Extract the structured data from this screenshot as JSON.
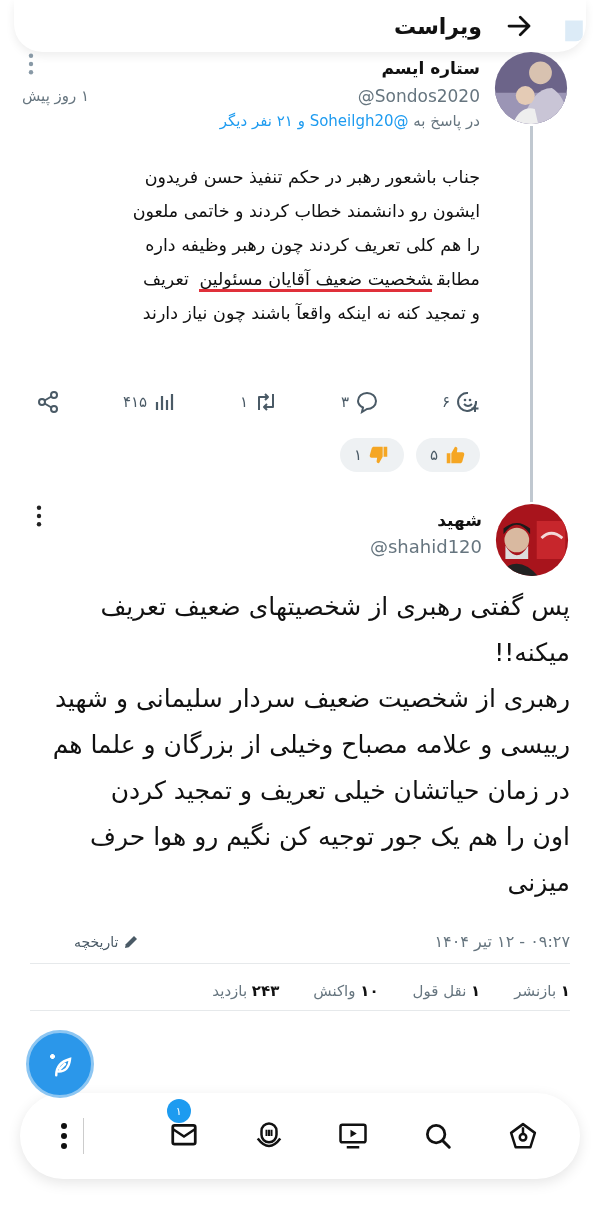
{
  "header": {
    "title": "ویراست"
  },
  "reply_post": {
    "name": "ستاره ایسم",
    "handle": "@Sondos2020",
    "time": "۱ روز پیش",
    "reply_prefix": "در پاسخ به",
    "reply_link": "@Soheilgh20 و ۲۱ نفر دیگر",
    "body_lines": [
      {
        "text": "جناب باشعور رهبر در حکم تنفیذ حسن فریدون"
      },
      {
        "text": "ایشون رو دانشمند خطاب کردند و خاتمی ملعون"
      },
      {
        "text": "را هم کلی تعریف کردند چون رهبر وظیفه داره"
      },
      {
        "text": "مطابق",
        "marked": "شخصیت ضعیف آقایان مسئولین",
        "after": "تعریف"
      },
      {
        "text": "و تمجید کنه نه اینکه واقعآ باشند چون نیاز دارند"
      }
    ],
    "actions": [
      {
        "kind": "react",
        "count": "۶"
      },
      {
        "kind": "reply",
        "count": "۳"
      },
      {
        "kind": "repost",
        "count": "۱"
      },
      {
        "kind": "views",
        "count": "۴۱۵"
      },
      {
        "kind": "share"
      }
    ],
    "reactions": [
      {
        "kind": "like",
        "count": "۵"
      },
      {
        "kind": "dislike",
        "count": "۱"
      }
    ]
  },
  "main_post": {
    "name": "شهید",
    "handle": "@shahid120",
    "body": "پس گفتی رهبری از شخصیتهای ضعیف تعریف میکنه!!\nرهبری از شخصیت ضعیف سردار سلیمانی و شهید رییسی و علامه مصباح وخیلی از بزرگان و علما هم در زمان حیاتشان خیلی تعریف و تمجید کردن\nاون را هم یک جور توجیه کن نگیم رو هوا حرف میزنی",
    "date": "۰۹:۲۷ - ۱۲ تیر ۱۴۰۴",
    "history": "تاریخچه",
    "stats": [
      {
        "count": "۱",
        "label": "بازنشر"
      },
      {
        "count": "۱",
        "label": "نقل قول"
      },
      {
        "count": "۱۰",
        "label": "واکنش"
      },
      {
        "count": "۲۴۳",
        "label": "بازدید"
      }
    ]
  },
  "bottom_nav": [
    {
      "kind": "home"
    },
    {
      "kind": "search"
    },
    {
      "kind": "video"
    },
    {
      "kind": "podcast"
    },
    {
      "kind": "mail",
      "badge": "۱"
    },
    {
      "kind": "more"
    }
  ]
}
